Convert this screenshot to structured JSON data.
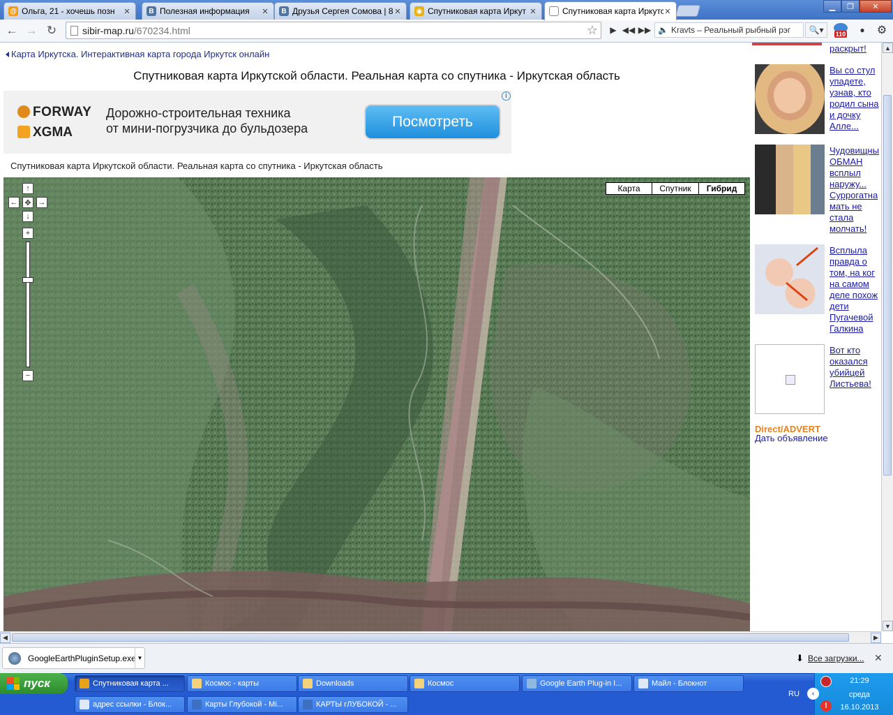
{
  "browser": {
    "tabs": [
      {
        "label": "Ольга, 21 - хочешь позн",
        "icon": "odnoklassniki-icon",
        "active": false
      },
      {
        "label": "Полезная информация",
        "icon": "vk-icon",
        "active": false
      },
      {
        "label": "Друзья Сергея Сомова | 83",
        "icon": "vk-icon",
        "active": false
      },
      {
        "label": "Спутниковая карта Иркут",
        "icon": "map-site-icon",
        "active": false
      },
      {
        "label": "Спутниковая карта Иркутс",
        "icon": "page-icon",
        "active": true
      }
    ],
    "url_host": "sibir-map.ru",
    "url_path": "/670234.html",
    "player_track": "Kravts – Реальный рыбный рэг",
    "badge_count": "110"
  },
  "page": {
    "breadcrumb": "Карта Иркутска. Интерактивная карта города Иркутск онлайн",
    "title": "Спутниковая карта Иркутской области. Реальная карта со спутника - Иркутская область",
    "subtitle": "Спутниковая карта Иркутской области. Реальная карта со спутника - Иркутская область",
    "ad": {
      "brand1": "FORWAY",
      "brand2": "XGMA",
      "line1": "Дорожно-строительная техника",
      "line2": "от мини-погрузчика до бульдозера",
      "button": "Посмотреть",
      "info": "i"
    },
    "map": {
      "type_buttons": [
        "Карта",
        "Спутник",
        "Гибрид"
      ],
      "selected_type": "Гибрид",
      "zoom_in": "+",
      "zoom_out": "−",
      "pan_up": "↑",
      "pan_down": "↓",
      "pan_left": "←",
      "pan_right": "→",
      "pan_center": "✥"
    },
    "sidebar": {
      "top_link": "раскрыт!",
      "promos": [
        {
          "text": "Вы со стул\nупадете,\nузнав, кто\nродил сына\nи дочку\nАлле...",
          "image": "singer-portrait"
        },
        {
          "text": "Чудовищны\nОБМАН\nвсплыл\nнаружу...\nСуррогатна\nмать не\nстала\nмолчать!",
          "image": "couple-photo"
        },
        {
          "text": "Всплыла\nправда о\nтом, на ког\nна самом\nделе похож\nдети\nПугачевой\nГалкина",
          "image": "babies-photo"
        },
        {
          "text": "Вот кто\nоказался\nубийцей\nЛистьева!",
          "image": "broken-image"
        }
      ],
      "direct_label": "Direct/ADVERT",
      "place_ad": "Дать объявление"
    }
  },
  "download_bar": {
    "file": "GoogleEarthPluginSetup.exe",
    "all_downloads": "Все загрузки..."
  },
  "taskbar": {
    "start": "пуск",
    "row1": [
      {
        "label": "Спутниковая карта ...",
        "active": true,
        "color": "#e8a21a"
      },
      {
        "label": "Космос - карты",
        "active": false,
        "color": "#f3d27a"
      },
      {
        "label": "Downloads",
        "active": false,
        "color": "#f3d27a"
      },
      {
        "label": "Космос",
        "active": false,
        "color": "#f3d27a"
      },
      {
        "label": "Google Earth Plug-in I...",
        "active": false,
        "color": "#8fb8e0"
      },
      {
        "label": "Майл - Блокнот",
        "active": false,
        "color": "#dfe9f5"
      }
    ],
    "row2": [
      {
        "label": "адрес ссылки - Блок...",
        "active": false,
        "color": "#dfe9f5"
      },
      {
        "label": "Карты Глубокой - Mi...",
        "active": false,
        "color": "#3d6fc2"
      },
      {
        "label": "КАРТЫ гЛУБОКОЙ - ...",
        "active": false,
        "color": "#3d6fc2"
      }
    ],
    "lang": "RU",
    "time": "21:29",
    "day": "среда",
    "date": "16.10.2013"
  }
}
